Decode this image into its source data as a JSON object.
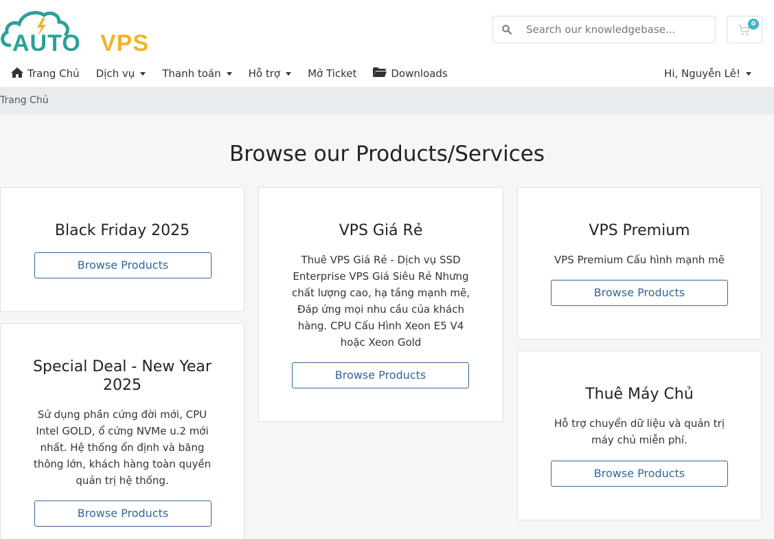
{
  "brand": {
    "logo_text_left": "AUTO",
    "logo_text_right": "VPS",
    "teal": "#2aa198",
    "yellow": "#f0b429"
  },
  "search": {
    "placeholder": "Search our knowledgebase..."
  },
  "cart": {
    "count": "0"
  },
  "nav": {
    "home": "Trang Chủ",
    "services": "Dịch vụ",
    "billing": "Thanh toán",
    "support": "Hỗ trợ",
    "open_ticket": "Mở Ticket",
    "downloads": "Downloads",
    "user": "Hi, Nguyễn Lê!"
  },
  "breadcrumb": {
    "home": "Trang Chủ"
  },
  "main": {
    "title": "Browse our Products/Services",
    "button_label": "Browse Products",
    "cards": [
      {
        "title": "Black Friday 2025",
        "description": ""
      },
      {
        "title": "VPS Giá Rẻ",
        "description": "Thuê VPS Giá Rẻ - Dịch vụ SSD Enterprise VPS Giá Siêu Rẻ Nhưng chất lượng cao, hạ tầng mạnh mẽ, Đáp ứng mọi nhu cầu của khách hàng. CPU Cấu Hình Xeon E5 V4 hoặc Xeon Gold"
      },
      {
        "title": "VPS Premium",
        "description": "VPS Premium Cấu hình mạnh mẽ"
      },
      {
        "title": "Special Deal - New Year 2025",
        "description": "Sử dụng phần cứng đời mới, CPU Intel GOLD, ổ cứng NVMe u.2 mới nhất. Hệ thống ổn định và băng thông lớn, khách hàng toàn quyền quản trị hệ thống."
      },
      {
        "title": "Thuê Máy Chủ",
        "description": "Hỗ trợ chuyển dữ liệu và quản trị máy chủ miễn phí."
      }
    ]
  }
}
